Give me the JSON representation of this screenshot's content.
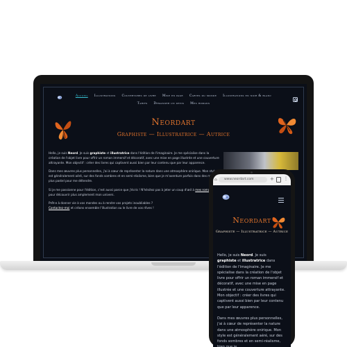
{
  "desktop": {
    "nav": {
      "row1": [
        "Accueil",
        "Illustrations",
        "Couvertures de livre",
        "Mise en page",
        "Cartes du monde",
        "Illustrations en noir & blanc"
      ],
      "row2": [
        "Tarifs",
        "Demander un devis",
        "Mes romans"
      ],
      "active_index": 0
    },
    "title": "Neordart",
    "subtitle": "Graphiste — Illustratrice — Autrice",
    "intro": {
      "p1_a": "Hello, je suis ",
      "p1_name": "Neord",
      "p1_b": ". Je suis ",
      "p1_role1": "graphiste",
      "p1_c": " et ",
      "p1_role2": "illustratrice",
      "p1_d": " dans l'édition de l'imaginaire. Je me spécialise dans la création de l'objet livre pour offrir un roman immersif et décoratif, avec une mise en page illustrée et une couverture attrayante. Mon objectif : créer des livres qui captivent aussi bien par leur contenu que par leur apparence.",
      "p2": "Dans mes œuvres plus personnelles, j'ai à cœur de représenter la nature dans une atmosphère onirique. Mon style est généralement aéré, sur des fonds sombres et en semi-réalisme, bien que je m'aventure parfois dans des mondes plus pastel pour me détendre.",
      "p3_a": "Si je me passionne pour l'édition, c'est aussi parce que j'écris ! N'hésitez pas à jeter un coup d'œil à ",
      "p3_link": "mes romans",
      "p3_b": " pour découvrir plus amplement mon univers.",
      "p4_a": "Prêt·e à donner vie à vos mondes ou à rendre vos projets inoubliables ?",
      "p4_link": "Contactez-moi",
      "p4_b": " et créons ensemble l'illustration ou le livre de vos rêves !"
    }
  },
  "mobile": {
    "url": "www.neordart.com",
    "title": "Neordart",
    "subtitle": "Graphiste — Illustratrice — Autrice",
    "p1_a": "Hello, je suis ",
    "p1_name": "Neord",
    "p1_b": ". Je suis ",
    "p1_role1": "graphiste",
    "p1_c": " et ",
    "p1_role2": "illustratrice",
    "p1_d": " dans l'édition de l'imaginaire. Je me spécialise dans la création de l'objet livre pour offrir un roman immersif et décoratif, avec une mise en page illustrée et une couverture attrayante. Mon objectif : créer des livres qui captivent aussi bien par leur contenu que par leur apparence.",
    "p2": "Dans mes œuvres plus personnelles, j'ai à cœur de représenter la nature dans une atmosphère onirique. Mon style est généralement aéré, sur des fonds sombres et en semi-réalisme, bien que je"
  },
  "colors": {
    "background": "#0b0f18",
    "accent_orange": "#e3742c",
    "nav_active": "#38c2d4",
    "nav_text": "#c8d3e6"
  },
  "icons": [
    "logo-icon",
    "butterfly-icon",
    "instagram-icon",
    "menu-icon",
    "home-icon",
    "new-tab-icon",
    "tabs-icon",
    "more-icon"
  ]
}
